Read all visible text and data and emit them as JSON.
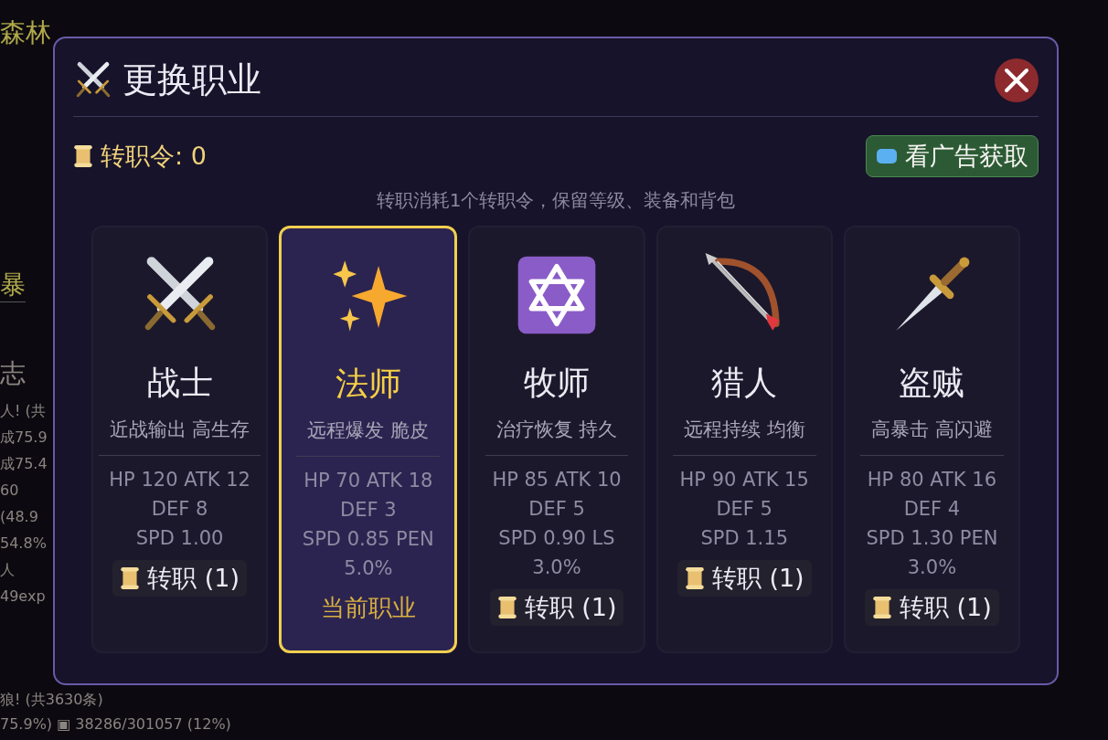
{
  "background_log": [
    "森林",
    "暴",
    "志",
    "人! (共",
    "成75.9",
    "成75.4",
    "60",
    "(48.9",
    "54.8%",
    "人",
    "49exp",
    "狼! (共3630条)",
    "75.9%) ▣ 38286/301057 (12%)"
  ],
  "dialog": {
    "title": "更换职业",
    "tokens_label": "转职令: 0",
    "ad_button": "看广告获取",
    "note": "转职消耗1个转职令，保留等级、装备和背包",
    "classes": [
      {
        "name": "战士",
        "tagline": "近战输出 高生存",
        "stats": [
          "HP 120 ATK 12",
          "DEF 8",
          "SPD 1.00"
        ],
        "selected": false,
        "action": "转职 (1)"
      },
      {
        "name": "法师",
        "tagline": "远程爆发 脆皮",
        "stats": [
          "HP 70 ATK 18",
          "DEF 3",
          "SPD 0.85 PEN",
          "5.0%"
        ],
        "selected": true,
        "action": "当前职业"
      },
      {
        "name": "牧师",
        "tagline": "治疗恢复 持久",
        "stats": [
          "HP 85 ATK 10",
          "DEF 5",
          "SPD 0.90 LS",
          "3.0%"
        ],
        "selected": false,
        "action": "转职 (1)"
      },
      {
        "name": "猎人",
        "tagline": "远程持续 均衡",
        "stats": [
          "HP 90 ATK 15",
          "DEF 5",
          "SPD 1.15"
        ],
        "selected": false,
        "action": "转职 (1)"
      },
      {
        "name": "盗贼",
        "tagline": "高暴击 高闪避",
        "stats": [
          "HP 80 ATK 16",
          "DEF 4",
          "SPD 1.30 PEN",
          "3.0%"
        ],
        "selected": false,
        "action": "转职 (1)"
      }
    ]
  }
}
